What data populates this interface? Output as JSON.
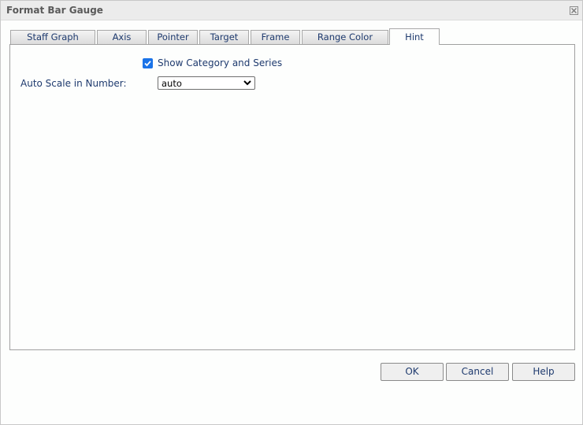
{
  "dialog": {
    "title": "Format Bar Gauge",
    "close_icon": "close-icon"
  },
  "tabs": [
    {
      "label": "Staff Graph",
      "active": false
    },
    {
      "label": "Axis",
      "active": false
    },
    {
      "label": "Pointer",
      "active": false
    },
    {
      "label": "Target",
      "active": false
    },
    {
      "label": "Frame",
      "active": false
    },
    {
      "label": "Range Color",
      "active": false
    },
    {
      "label": "Hint",
      "active": true
    }
  ],
  "hint": {
    "show_category_series": {
      "label": "Show Category and Series",
      "checked": true
    },
    "auto_scale": {
      "label": "Auto Scale in Number:",
      "value": "auto"
    }
  },
  "buttons": {
    "ok": "OK",
    "cancel": "Cancel",
    "help": "Help"
  },
  "colors": {
    "accent": "#1a73e8",
    "text": "#1e3a6e"
  }
}
